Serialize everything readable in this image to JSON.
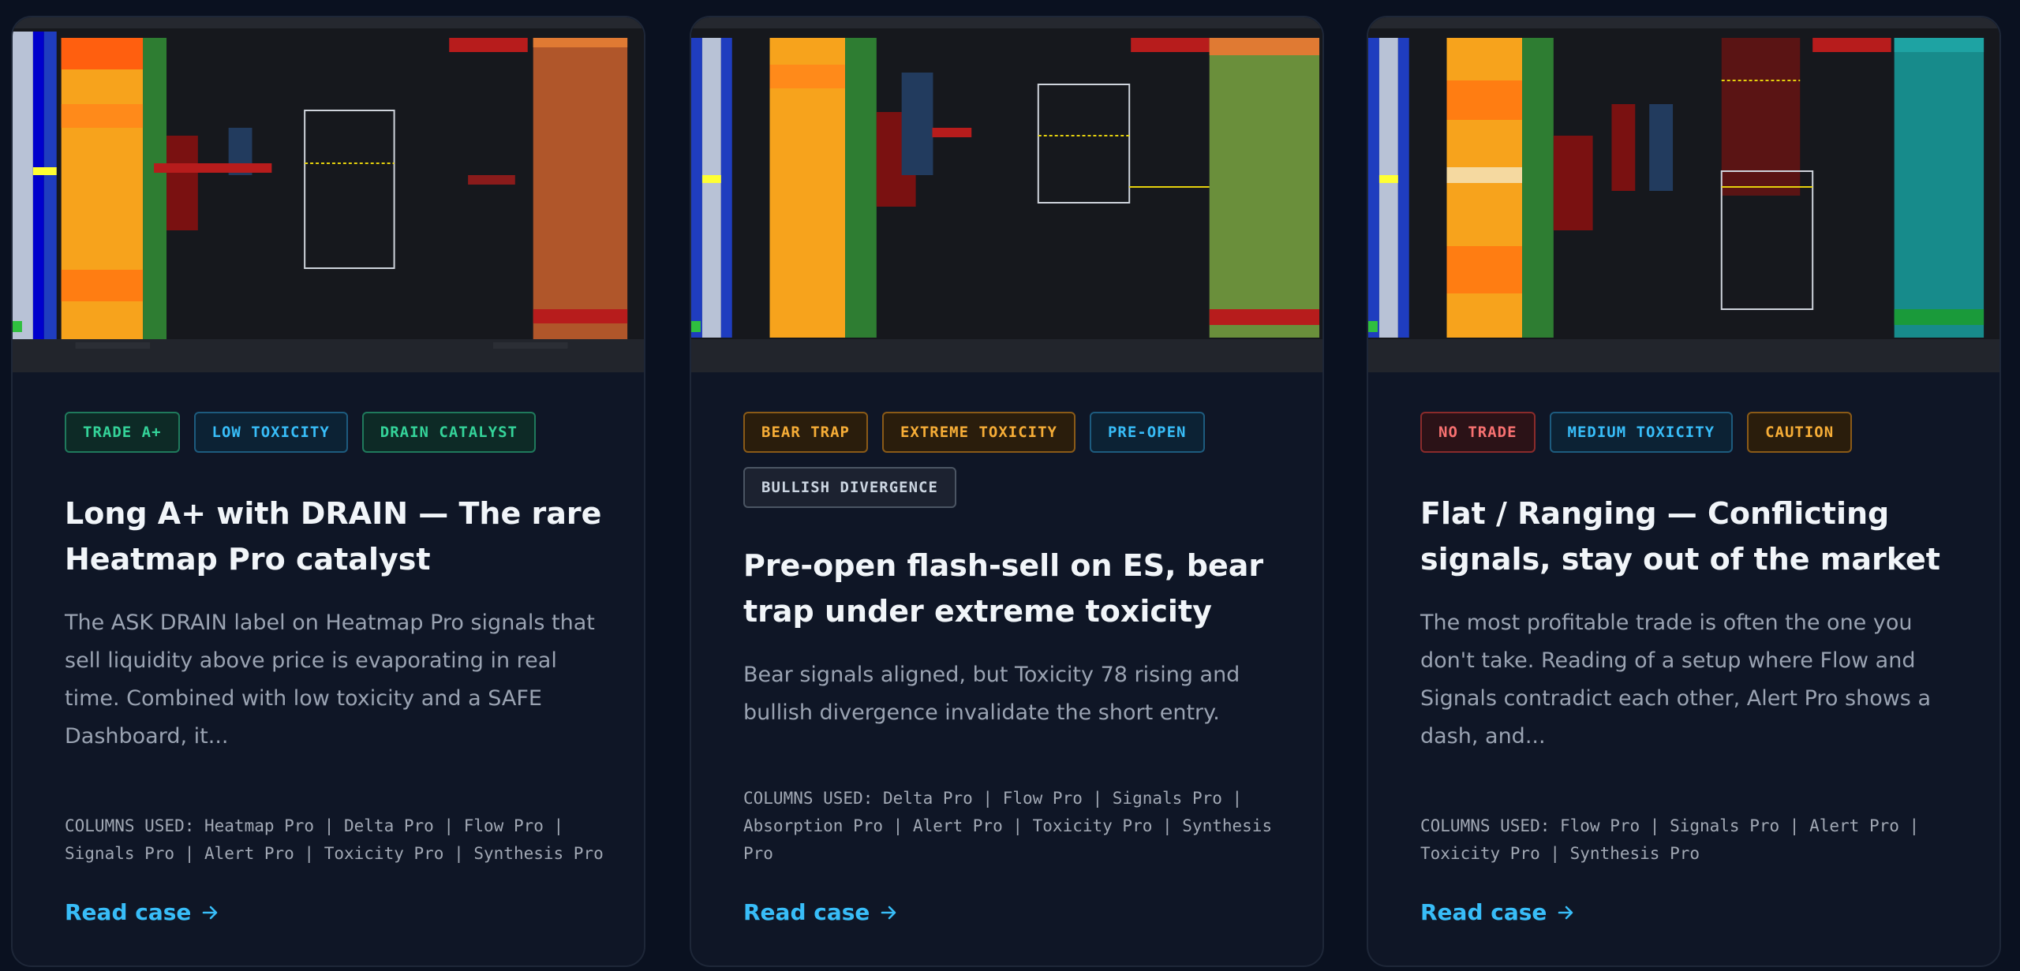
{
  "cards": [
    {
      "badges": [
        "TRADE A+",
        "LOW TOXICITY",
        "DRAIN CATALYST"
      ],
      "title": "Long A+ with DRAIN — The rare Heatmap Pro catalyst",
      "description": "The ASK DRAIN label on Heatmap Pro signals that sell liquidity above price is evaporating in real time. Combined with low toxicity and a SAFE Dashboard, it...",
      "columns_used": "COLUMNS USED: Heatmap Pro | Delta Pro | Flow Pro | Signals Pro | Alert Pro | Toxicity Pro | Synthesis Pro",
      "link": "Read case",
      "screenshot_alt": "Trading DOM screenshot"
    },
    {
      "badges": [
        "BEAR TRAP",
        "EXTREME TOXICITY",
        "PRE-OPEN",
        "BULLISH DIVERGENCE"
      ],
      "title": "Pre-open flash-sell on ES, bear trap under extreme toxicity",
      "description": "Bear signals aligned, but Toxicity 78 rising and bullish divergence invalidate the short entry.",
      "columns_used": "COLUMNS USED: Delta Pro | Flow Pro | Signals Pro | Absorption Pro | Alert Pro | Toxicity Pro | Synthesis Pro",
      "link": "Read case",
      "screenshot_alt": "Trading DOM screenshot"
    },
    {
      "badges": [
        "NO TRADE",
        "MEDIUM TOXICITY",
        "CAUTION"
      ],
      "title": "Flat / Ranging — Conflicting signals, stay out of the market",
      "description": "The most profitable trade is often the one you don't take. Reading of a setup where Flow and Signals contradict each other, Alert Pro shows a dash, and...",
      "columns_used": "COLUMNS USED: Flow Pro | Signals Pro | Alert Pro | Toxicity Pro | Synthesis Pro",
      "link": "Read case",
      "screenshot_alt": "Trading DOM screenshot"
    }
  ],
  "colors": {
    "accent": "#38bdf8",
    "green": "#34d399",
    "amber": "#f6ad37",
    "red": "#f87171",
    "gray": "#cbd5e1"
  }
}
